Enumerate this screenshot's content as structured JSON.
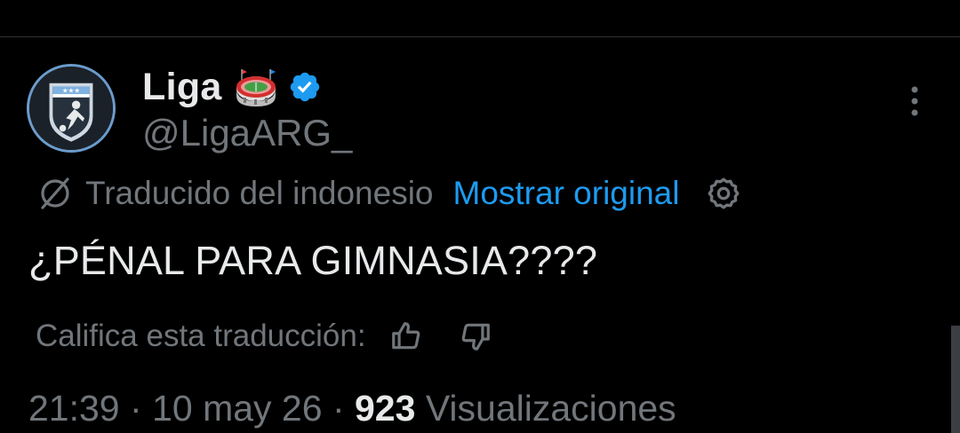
{
  "tweet": {
    "author": {
      "display_name": "Liga",
      "emoji_icon": "stadium-emoji",
      "verified": true,
      "handle": "@LigaARG_",
      "avatar_icon": "liga-argentina-logo"
    },
    "translation": {
      "label": "Traducido del indonesio",
      "show_original": "Mostrar original"
    },
    "text": "¿PÉNAL PARA GIMNASIA????",
    "rate_translation": {
      "label": "Califica esta traducción:"
    },
    "meta": {
      "time": "21:39",
      "separator": "·",
      "date": "10 may 26",
      "views_count": "923",
      "views_label": "Visualizaciones"
    }
  },
  "colors": {
    "background": "#000000",
    "primary_text": "#e7e9ea",
    "secondary_text": "#71767b",
    "link": "#1d9bf0",
    "verified": "#1d9bf0"
  }
}
